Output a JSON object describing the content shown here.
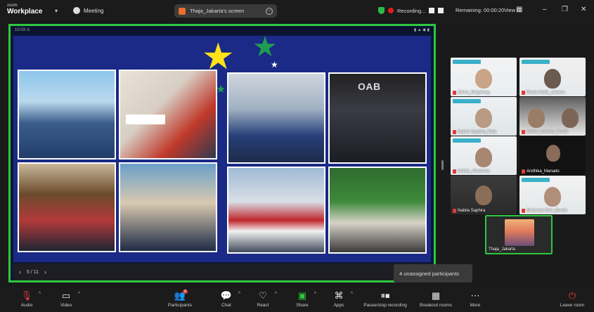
{
  "topbar": {
    "brand_small": "zoom",
    "brand_big": "Workplace",
    "meeting_label": "Meeting",
    "shared_screen_label": "Thaja_Jakarta's screen",
    "recording_label": "Recording...",
    "remaining_label": "Remaining: 00:00:20",
    "view_label": "View",
    "minimize": "–",
    "maximize": "❐",
    "close": "✕"
  },
  "share": {
    "page_indicator": "5 / 11",
    "unassigned_label": "4 unassigned participants",
    "status_left": "10:03  ⊙",
    "status_right": "▮ ▲ ◆ ▮"
  },
  "gallery": [
    {
      "name": "Zahra_Magelang"
    },
    {
      "name": "Rania Naibt_Jakarta"
    },
    {
      "name": "Nabila Saphira_Pala"
    },
    {
      "name": "Arshe_Lokawo_Surab"
    },
    {
      "name": "Nabila_Alkamran"
    },
    {
      "name": "Andhika_Manado"
    },
    {
      "name": "Nabila Saphira"
    },
    {
      "name": "Maharani Sari_Bandu"
    },
    {
      "name": "Thaja_Jakarta"
    }
  ],
  "toolbar": {
    "audio": "Audio",
    "video": "Video",
    "participants": "Participants",
    "participants_count": "9",
    "chat": "Chat",
    "react": "React",
    "share": "Share",
    "apps": "Apps",
    "pause_recording": "Pause/stop recording",
    "breakout_rooms": "Breakout rooms",
    "more": "More",
    "leave": "Leave room"
  },
  "colors": {
    "accent_green": "#2dc83f",
    "mute_red": "#e23a3a",
    "slide_blue": "#1a2a86",
    "star_yellow": "#ffe21a"
  }
}
